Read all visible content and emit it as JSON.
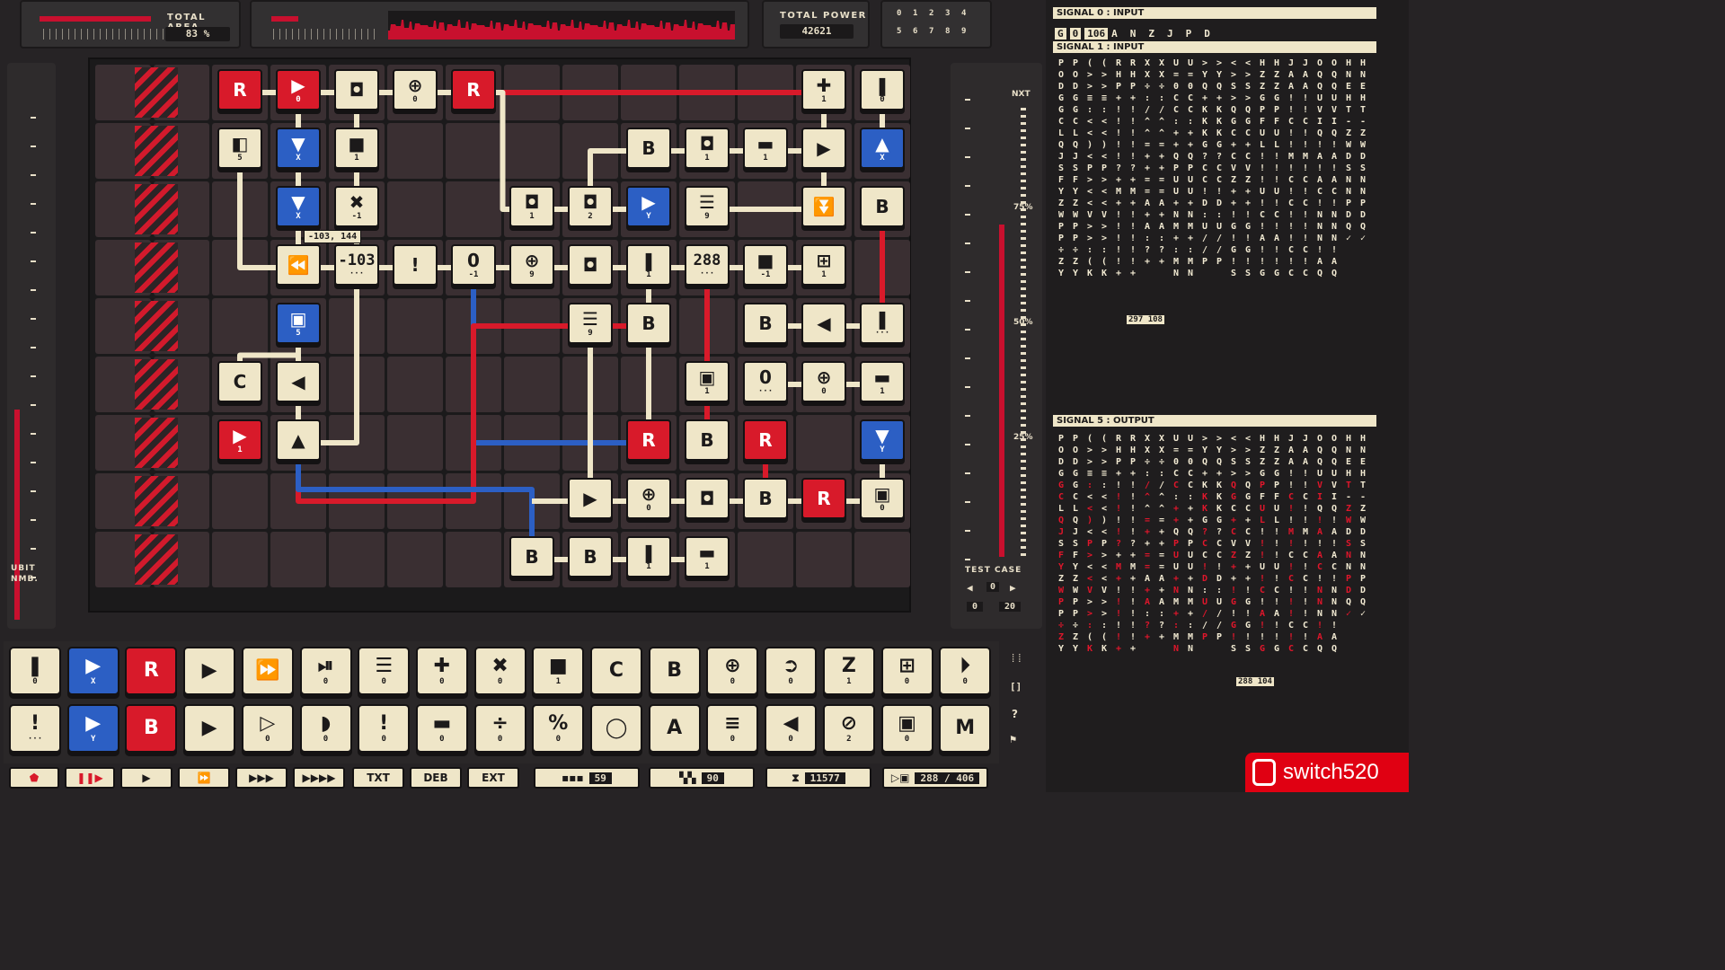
{
  "header": {
    "total_area_label": "TOTAL AREA",
    "total_area_value": "83 %",
    "total_power_label": "TOTAL POWER",
    "total_power_value": "42621",
    "digit_grid": [
      "0",
      "1",
      "2",
      "3",
      "4",
      "5",
      "6",
      "7",
      "8",
      "9"
    ]
  },
  "left_panel": {
    "label_1": "UBIT",
    "label_2": "NMB."
  },
  "right_meter": {
    "next_label": "NXT",
    "pct_75": "75%",
    "pct_50": "50%",
    "pct_25": "25%",
    "test_case_label": "TEST CASE",
    "test_case_value": "0",
    "range_start": "0",
    "range_end": "20"
  },
  "blocks": [
    {
      "g": "R",
      "s": "",
      "c": "r"
    },
    {
      "g": "▶",
      "s": "0",
      "c": "r"
    },
    {
      "g": "◘",
      "s": "",
      "c": "y"
    },
    {
      "g": "⊕",
      "s": "0",
      "c": "y"
    },
    {
      "g": "R",
      "s": "",
      "c": "r"
    },
    {
      "g": "✚",
      "s": "1",
      "c": "y"
    },
    {
      "g": "❚",
      "s": "0",
      "c": "y"
    },
    {
      "g": "◧",
      "s": "5",
      "c": "y"
    },
    {
      "g": "▼",
      "s": "X",
      "c": "b"
    },
    {
      "g": "■",
      "s": "1",
      "c": "y"
    },
    {
      "g": "B",
      "s": "",
      "c": "y"
    },
    {
      "g": "◘",
      "s": "1",
      "c": "y"
    },
    {
      "g": "▬",
      "s": "1",
      "c": "y"
    },
    {
      "g": "▶",
      "s": "",
      "c": "y"
    },
    {
      "g": "▲",
      "s": "X",
      "c": "b"
    },
    {
      "g": "▼",
      "s": "X",
      "c": "b"
    },
    {
      "g": "✖",
      "s": "-1",
      "c": "y"
    },
    {
      "g": "◘",
      "s": "1",
      "c": "y"
    },
    {
      "g": "◘",
      "s": "2",
      "c": "y"
    },
    {
      "g": "▶",
      "s": "Y",
      "c": "b"
    },
    {
      "g": "☰",
      "s": "9",
      "c": "y"
    },
    {
      "g": "⏬",
      "s": "",
      "c": "y"
    },
    {
      "g": "B",
      "s": "",
      "c": "y"
    },
    {
      "g": "⏪",
      "s": "",
      "c": "y"
    },
    {
      "g": "-103",
      "s": "···",
      "c": "y"
    },
    {
      "g": "!",
      "s": "",
      "c": "y"
    },
    {
      "g": "0",
      "s": "-1",
      "c": "y"
    },
    {
      "g": "⊕",
      "s": "9",
      "c": "y"
    },
    {
      "g": "◘",
      "s": "",
      "c": "y"
    },
    {
      "g": "❚",
      "s": "1",
      "c": "y"
    },
    {
      "g": "288",
      "s": "···",
      "c": "y"
    },
    {
      "g": "■",
      "s": "-1",
      "c": "y"
    },
    {
      "g": "⊞",
      "s": "1",
      "c": "y"
    },
    {
      "g": "▣",
      "s": "5",
      "c": "b"
    },
    {
      "g": "☰",
      "s": "9",
      "c": "y"
    },
    {
      "g": "B",
      "s": "",
      "c": "y"
    },
    {
      "g": "B",
      "s": "",
      "c": "y"
    },
    {
      "g": "◀",
      "s": "",
      "c": "y"
    },
    {
      "g": "❚",
      "s": "···",
      "c": "y"
    },
    {
      "g": "C",
      "s": "",
      "c": "y"
    },
    {
      "g": "◀",
      "s": "",
      "c": "y"
    },
    {
      "g": "▣",
      "s": "1",
      "c": "y"
    },
    {
      "g": "0",
      "s": "···",
      "c": "y"
    },
    {
      "g": "⊕",
      "s": "0",
      "c": "y"
    },
    {
      "g": "▬",
      "s": "1",
      "c": "y"
    },
    {
      "g": "▶",
      "s": "1",
      "c": "r"
    },
    {
      "g": "▲",
      "s": "",
      "c": "y"
    },
    {
      "g": "R",
      "s": "",
      "c": "r"
    },
    {
      "g": "B",
      "s": "",
      "c": "y"
    },
    {
      "g": "R",
      "s": "",
      "c": "r"
    },
    {
      "g": "▼",
      "s": "Y",
      "c": "b"
    },
    {
      "g": "▶",
      "s": "",
      "c": "y"
    },
    {
      "g": "⊕",
      "s": "0",
      "c": "y"
    },
    {
      "g": "◘",
      "s": "",
      "c": "y"
    },
    {
      "g": "B",
      "s": "",
      "c": "y"
    },
    {
      "g": "R",
      "s": "",
      "c": "r"
    },
    {
      "g": "▣",
      "s": "0",
      "c": "y"
    },
    {
      "g": "B",
      "s": "",
      "c": "y"
    },
    {
      "g": "B",
      "s": "",
      "c": "y"
    },
    {
      "g": "❚",
      "s": "1",
      "c": "y"
    },
    {
      "g": "▬",
      "s": "1",
      "c": "y"
    }
  ],
  "tooltip": "-103, 144",
  "palette_row1": [
    {
      "g": "❚",
      "s": "0",
      "c": "y"
    },
    {
      "g": "▶",
      "s": "X",
      "c": "b"
    },
    {
      "g": "R",
      "s": "",
      "c": "r"
    },
    {
      "g": "▶",
      "s": "",
      "c": "y"
    },
    {
      "g": "⏩",
      "s": "",
      "c": "y"
    },
    {
      "g": "⏯",
      "s": "0",
      "c": "y"
    },
    {
      "g": "☰",
      "s": "0",
      "c": "y"
    },
    {
      "g": "✚",
      "s": "0",
      "c": "y"
    },
    {
      "g": "✖",
      "s": "0",
      "c": "y"
    },
    {
      "g": "■",
      "s": "1",
      "c": "y"
    },
    {
      "g": "C",
      "s": "",
      "c": "y"
    },
    {
      "g": "B",
      "s": "",
      "c": "y"
    },
    {
      "g": "⊕",
      "s": "0",
      "c": "y"
    },
    {
      "g": "➲",
      "s": "0",
      "c": "y"
    },
    {
      "g": "Z",
      "s": "1",
      "c": "y"
    },
    {
      "g": "⊞",
      "s": "0",
      "c": "y"
    },
    {
      "g": "⏵",
      "s": "0",
      "c": "y"
    }
  ],
  "palette_row2": [
    {
      "g": "!",
      "s": "···",
      "c": "y"
    },
    {
      "g": "▶",
      "s": "Y",
      "c": "b"
    },
    {
      "g": "B",
      "s": "",
      "c": "r"
    },
    {
      "g": "▶",
      "s": "",
      "c": "y"
    },
    {
      "g": "▷",
      "s": "0",
      "c": "y"
    },
    {
      "g": "◗",
      "s": "0",
      "c": "y"
    },
    {
      "g": "!",
      "s": "0",
      "c": "y"
    },
    {
      "g": "▬",
      "s": "0",
      "c": "y"
    },
    {
      "g": "÷",
      "s": "0",
      "c": "y"
    },
    {
      "g": "%",
      "s": "0",
      "c": "y"
    },
    {
      "g": "◯",
      "s": "",
      "c": "y"
    },
    {
      "g": "A",
      "s": "",
      "c": "y"
    },
    {
      "g": "≡",
      "s": "0",
      "c": "y"
    },
    {
      "g": "◀",
      "s": "0",
      "c": "y"
    },
    {
      "g": "⊘",
      "s": "2",
      "c": "y"
    },
    {
      "g": "▣",
      "s": "0",
      "c": "y"
    },
    {
      "g": "M",
      "s": "",
      "c": "y"
    }
  ],
  "side_buttons": [
    "[]",
    "?",
    "⚑"
  ],
  "toolbar": {
    "txt": "TXT",
    "deb": "DEB",
    "ext": "EXT",
    "blocks_count": "59",
    "cells_count": "90",
    "cycles": "11577",
    "progress": "288 / 406"
  },
  "signal0": {
    "title": "SIGNAL 0 : INPUT",
    "values": [
      "G",
      "0",
      "106",
      "A",
      "N",
      "Z",
      "J",
      "P",
      "D"
    ]
  },
  "signal1": {
    "title": "SIGNAL 1 : INPUT",
    "columns": [
      "PODGGCLQJSFYZWPP÷ZY",
      "(>>≡:<<)<P><<V>>:(K",
      "RHP+!!!!!?+M+!!!!!+",
      "XX÷:/^^=++==A+A:?+",
      "U=0CC:++QPUU+NM+:MN",
      ">YQ+KKKG?CC!D:U//P",
      "<>S>QGC+CVZ++!G!G!S",
      "HZZGPFUL!!!U!C!A!!G",
      "JAA!!C!!M!C!C!!!C!C",
      "OQQUVIQ!A!AC!NNN!AQ",
      "HNEHT-ZWDSNNPDQ✓"
    ],
    "badge_a": "297",
    "badge_b": "108"
  },
  "signal5": {
    "title": "SIGNAL 5 : OUTPUT",
    "columns": [
      "PODGGCLQJSFYZWPP÷ZY",
      "(>>≡:<<)<P><<V>>:(K",
      "RHP+!!!!!?+M+!!!!!+",
      "XX÷:/^^=++==A+A:?+",
      "U=0CC:++QPUU+NM+:MN",
      ">YQ+KKKG?CC!D:U//P",
      "<>S>QGC+CVZ++!G!G!S",
      "HZZGPFUL!!!U!C!A!!G",
      "JAA!!C!!M!C!C!!!C!C",
      "OQQUVIQ!A!AC!NNN!AQ",
      "HNEHT-ZWDSNNPDQ✓"
    ],
    "badge_a": "288",
    "badge_b": "104"
  },
  "watermark": "switch520",
  "colors": {
    "accent_red": "#d81a2a",
    "accent_blue": "#2c5fc4",
    "block_cream": "#efe6c8",
    "board_bg": "#3a2f32"
  }
}
